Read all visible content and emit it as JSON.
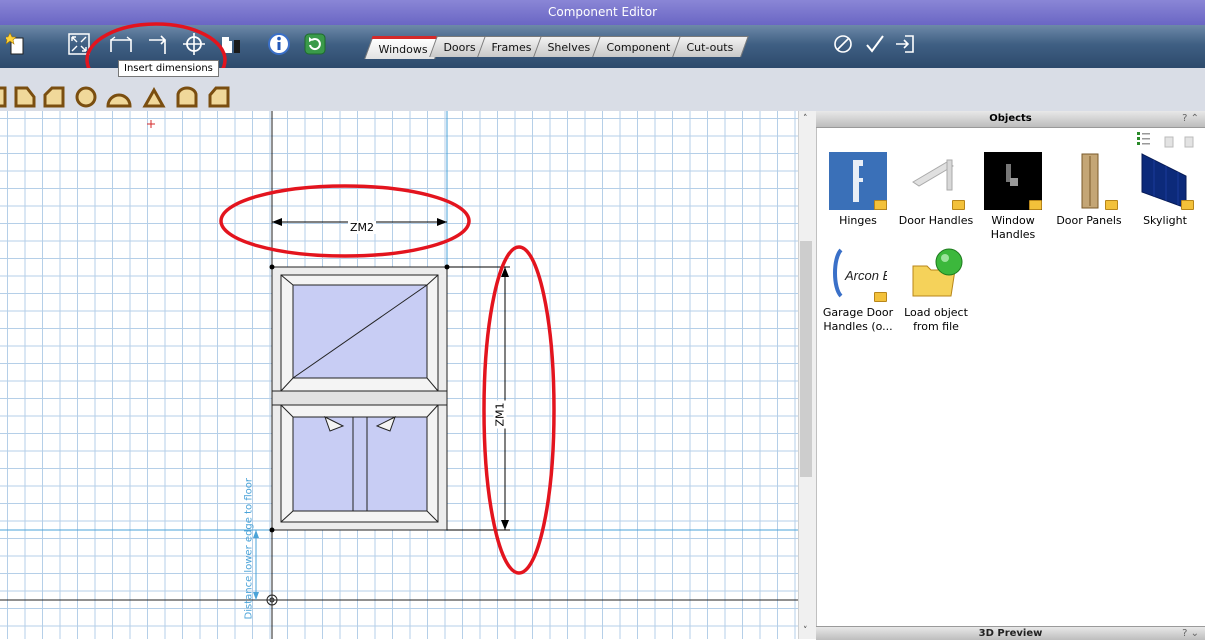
{
  "window": {
    "title": "Component Editor"
  },
  "toolbar": {
    "tabs": [
      {
        "label": "Windows",
        "active": true
      },
      {
        "label": "Doors",
        "active": false
      },
      {
        "label": "Frames",
        "active": false
      },
      {
        "label": "Shelves",
        "active": false
      },
      {
        "label": "Component",
        "active": false
      },
      {
        "label": "Cut-outs",
        "active": false
      }
    ],
    "tooltip": "Insert dimensions"
  },
  "canvas": {
    "dimension_horizontal": "ZM2",
    "dimension_vertical": "ZM1",
    "floor_distance_label": "Distance lower edge to floor"
  },
  "objects_panel": {
    "title": "Objects",
    "items": [
      {
        "label": "Hinges",
        "icon": "hinge-icon"
      },
      {
        "label": "Door Handles",
        "icon": "door-handle-icon"
      },
      {
        "label": "Window Handles",
        "icon": "window-handle-icon"
      },
      {
        "label": "Door Panels",
        "icon": "door-panel-icon"
      },
      {
        "label": "Skylight",
        "icon": "skylight-icon"
      },
      {
        "label": "Garage Door Handles (o...",
        "icon": "garage-handle-icon",
        "thumb_text": "Arcon Evo"
      },
      {
        "label": "Load object from file",
        "icon": "load-file-icon"
      }
    ]
  },
  "preview_panel": {
    "title": "3D Preview"
  },
  "colors": {
    "accent": "#d42a2a",
    "toolbar": "#3f5f83",
    "grid": "#b5cfe8",
    "glass": "#c8cdf4"
  }
}
